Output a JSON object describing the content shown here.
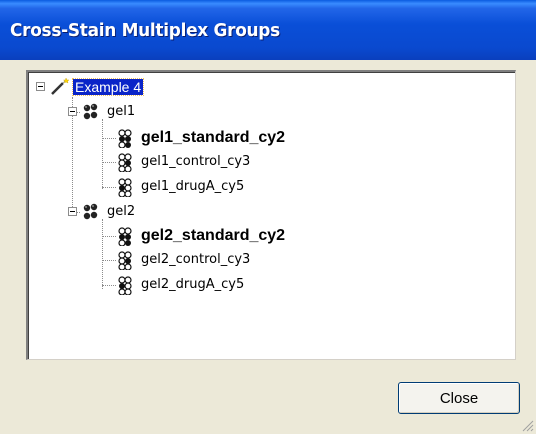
{
  "window": {
    "title": "Cross-Stain Multiplex Groups"
  },
  "tree": {
    "root": {
      "label": "Example 4",
      "icon": "wand-icon",
      "selected": true
    },
    "groups": [
      {
        "label": "gel1",
        "icon": "gel-group-icon",
        "children": [
          {
            "label": "gel1_standard_cy2",
            "bold": true,
            "icon": "gel-spots-icon"
          },
          {
            "label": "gel1_control_cy3",
            "bold": false,
            "icon": "gel-spots-icon"
          },
          {
            "label": "gel1_drugA_cy5",
            "bold": false,
            "icon": "gel-spots-icon"
          }
        ]
      },
      {
        "label": "gel2",
        "icon": "gel-group-icon",
        "children": [
          {
            "label": "gel2_standard_cy2",
            "bold": true,
            "icon": "gel-spots-icon"
          },
          {
            "label": "gel2_control_cy3",
            "bold": false,
            "icon": "gel-spots-icon"
          },
          {
            "label": "gel2_drugA_cy5",
            "bold": false,
            "icon": "gel-spots-icon"
          }
        ]
      }
    ]
  },
  "buttons": {
    "close_label": "Close"
  },
  "colors": {
    "titlebar": "#0A49CF",
    "selection": "#0A24C8",
    "dialog_bg": "#ECE9D8"
  }
}
